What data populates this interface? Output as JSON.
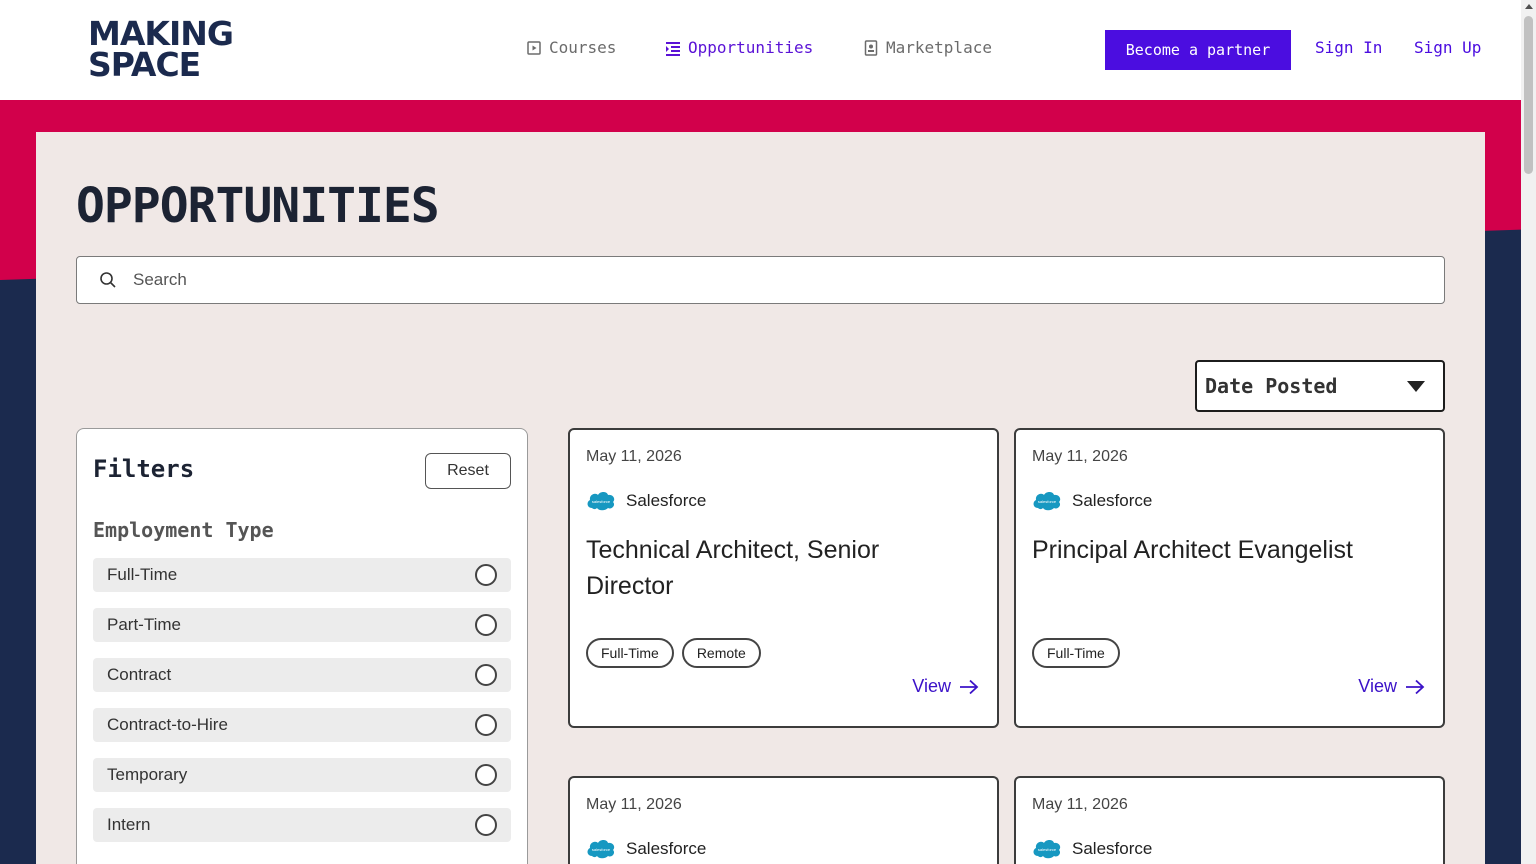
{
  "header": {
    "logo_line1": "MAKING",
    "logo_line2": "SPACE",
    "nav": [
      {
        "label": "Courses",
        "icon": "play-square-icon",
        "active": false
      },
      {
        "label": "Opportunities",
        "icon": "list-indent-icon",
        "active": true
      },
      {
        "label": "Marketplace",
        "icon": "id-badge-icon",
        "active": false
      }
    ],
    "partner_label": "Become a partner",
    "sign_in_label": "Sign In",
    "sign_up_label": "Sign Up"
  },
  "colors": {
    "accent": "#4b0de0",
    "brand_red": "#d2004b",
    "brand_navy": "#1b2a4e",
    "panel": "#f0e8e6"
  },
  "main": {
    "title": "OPPORTUNITIES",
    "search_placeholder": "Search",
    "sort_label": "Date Posted"
  },
  "filters": {
    "title": "Filters",
    "reset_label": "Reset",
    "employment_heading": "Employment Type",
    "options": [
      "Full-Time",
      "Part-Time",
      "Contract",
      "Contract-to-Hire",
      "Temporary",
      "Intern"
    ]
  },
  "cards": [
    {
      "date": "May 11, 2026",
      "company": "Salesforce",
      "title": "Technical Architect, Senior Director",
      "tags": [
        "Full-Time",
        "Remote"
      ],
      "view_label": "View"
    },
    {
      "date": "May 11, 2026",
      "company": "Salesforce",
      "title": "Principal Architect Evangelist",
      "tags": [
        "Full-Time"
      ],
      "view_label": "View"
    },
    {
      "date": "May 11, 2026",
      "company": "Salesforce",
      "title": "",
      "tags": [],
      "view_label": ""
    },
    {
      "date": "May 11, 2026",
      "company": "Salesforce",
      "title": "",
      "tags": [],
      "view_label": ""
    }
  ]
}
